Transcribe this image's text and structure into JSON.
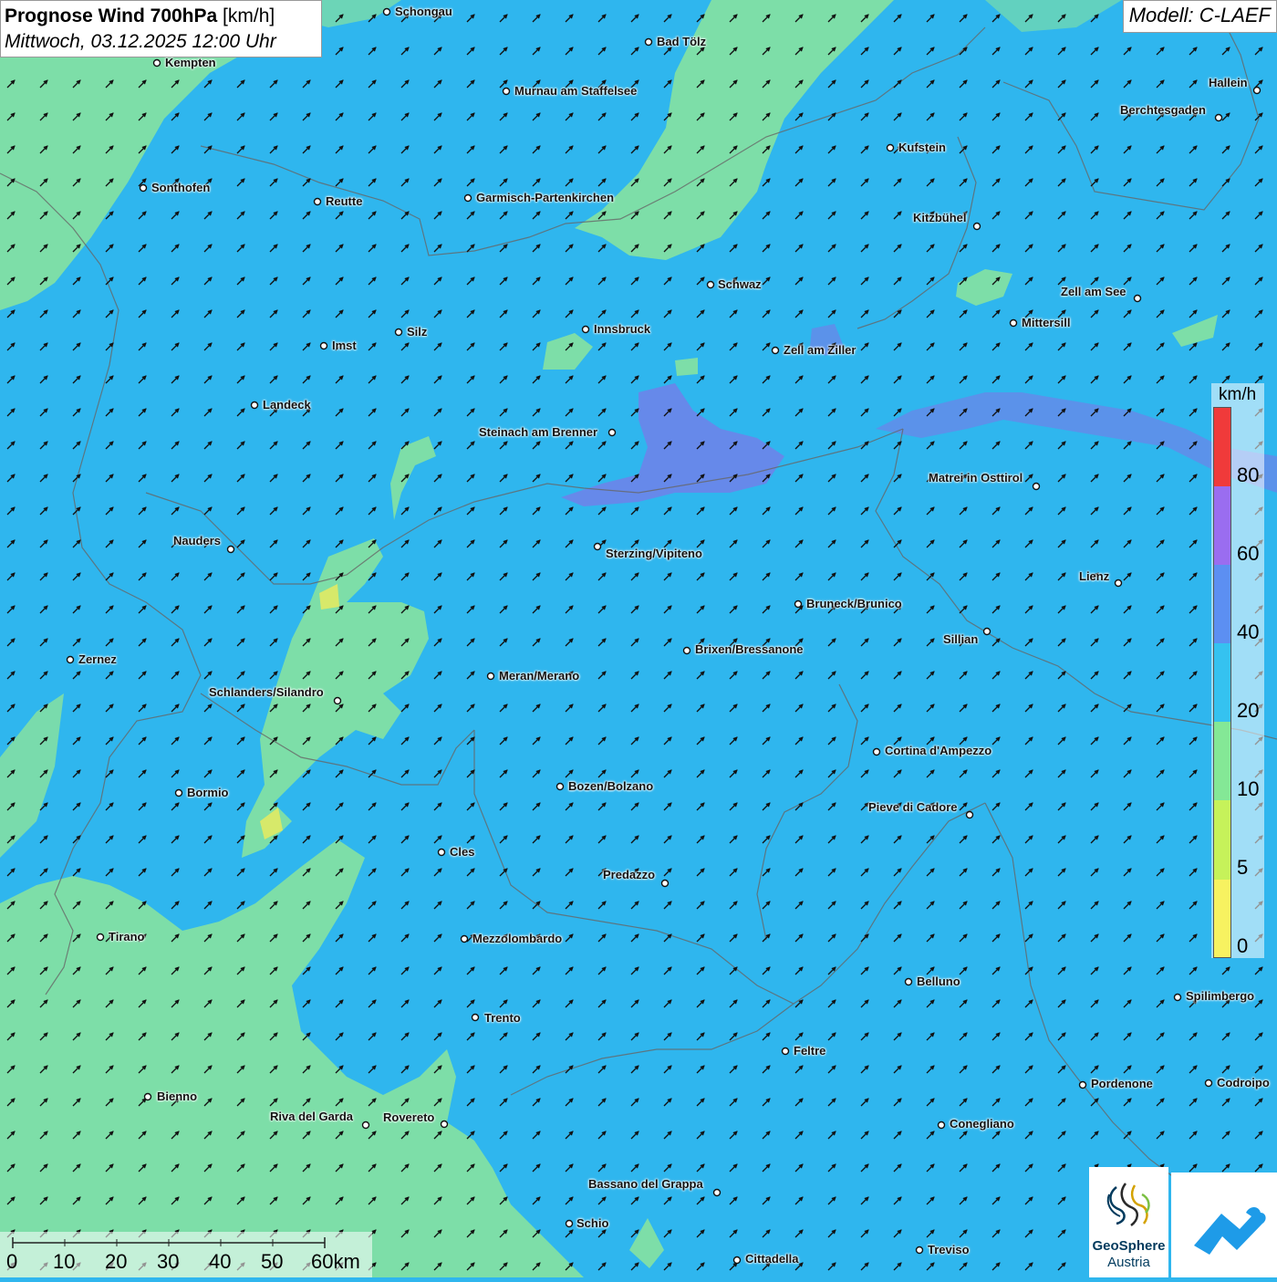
{
  "title": {
    "main": "Prognose Wind 700hPa",
    "unit": "[km/h]",
    "date": "Mittwoch, 03.12.2025 12:00 Uhr"
  },
  "model": "Modell: C-LAEF",
  "legend": {
    "unit": "km/h",
    "ticks": [
      "80",
      "60",
      "40",
      "20",
      "10",
      "5",
      "0"
    ],
    "colors": [
      "#f03a3a",
      "#9a6df0",
      "#5c8ff2",
      "#35c2f0",
      "#84e896",
      "#c6f25a",
      "#f7f260"
    ]
  },
  "scalebar": {
    "labels": [
      "0",
      "10",
      "20",
      "30",
      "40",
      "50",
      "60km"
    ]
  },
  "logo": {
    "name": "GeoSphere",
    "sub": "Austria"
  },
  "colors": {
    "sea_blue": "#2fb6ee",
    "green": "#86e2a0",
    "violet": "#7a7ae8",
    "yellow": "#d7e96a",
    "arrow": "#111111"
  },
  "wind_direction": "southwest",
  "cities": [
    {
      "name": "Schongau"
    },
    {
      "name": "Bad Tölz"
    },
    {
      "name": "Kempten"
    },
    {
      "name": "Murnau am Staffelsee"
    },
    {
      "name": "Hallein"
    },
    {
      "name": "Berchtesgaden"
    },
    {
      "name": "Kufstein"
    },
    {
      "name": "Sonthofen"
    },
    {
      "name": "Reutte"
    },
    {
      "name": "Garmisch-Partenkirchen"
    },
    {
      "name": "Kitzbühel"
    },
    {
      "name": "Schwaz"
    },
    {
      "name": "Zell am See"
    },
    {
      "name": "Mittersill"
    },
    {
      "name": "Innsbruck"
    },
    {
      "name": "Silz"
    },
    {
      "name": "Imst"
    },
    {
      "name": "Zell am Ziller"
    },
    {
      "name": "Landeck"
    },
    {
      "name": "Steinach am Brenner"
    },
    {
      "name": "Matrei in Osttirol"
    },
    {
      "name": "Nauders"
    },
    {
      "name": "Sterzing/Vipiteno"
    },
    {
      "name": "Lienz"
    },
    {
      "name": "Bruneck/Brunico"
    },
    {
      "name": "Sillian"
    },
    {
      "name": "Brixen/Bressanone"
    },
    {
      "name": "Zernez"
    },
    {
      "name": "Meran/Merano"
    },
    {
      "name": "Schlanders/Silandro"
    },
    {
      "name": "Cortina d'Ampezzo"
    },
    {
      "name": "Bozen/Bolzano"
    },
    {
      "name": "Bormio"
    },
    {
      "name": "Pieve di Cadore"
    },
    {
      "name": "Cles"
    },
    {
      "name": "Predazzo"
    },
    {
      "name": "Tirano"
    },
    {
      "name": "Mezzolombardo"
    },
    {
      "name": "Belluno"
    },
    {
      "name": "Spilimbergo"
    },
    {
      "name": "Trento"
    },
    {
      "name": "Feltre"
    },
    {
      "name": "Pordenone"
    },
    {
      "name": "Codroipo"
    },
    {
      "name": "Bienno"
    },
    {
      "name": "Riva del Garda"
    },
    {
      "name": "Rovereto"
    },
    {
      "name": "Conegliano"
    },
    {
      "name": "Bassano del Grappa"
    },
    {
      "name": "Schio"
    },
    {
      "name": "Treviso"
    },
    {
      "name": "Cittadella"
    }
  ]
}
